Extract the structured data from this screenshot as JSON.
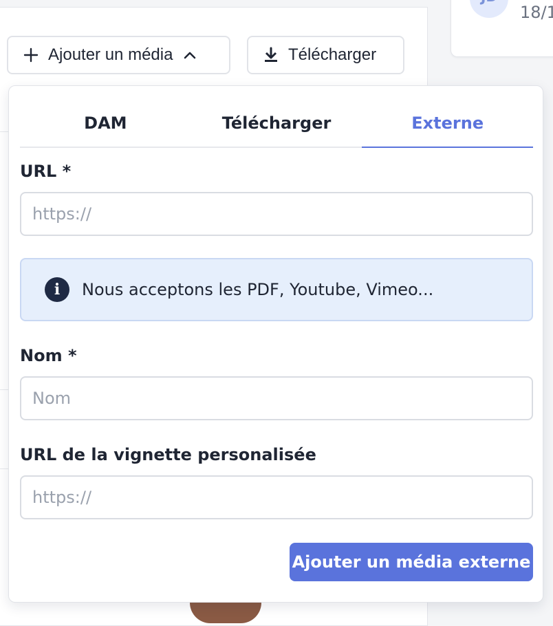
{
  "background": {
    "avatar_initials": "JD",
    "date_partial": "18/1"
  },
  "toolbar": {
    "add_media_label": "Ajouter un média",
    "download_label": "Télécharger"
  },
  "popover": {
    "tabs": [
      {
        "label": "DAM",
        "active": false
      },
      {
        "label": "Télécharger",
        "active": false
      },
      {
        "label": "Externe",
        "active": true
      }
    ],
    "url_label": "URL *",
    "url_placeholder": "https://",
    "info_text": "Nous acceptons les PDF, Youtube, Vimeo...",
    "name_label": "Nom *",
    "name_placeholder": "Nom",
    "thumbnail_label": "URL de la vignette personalisée",
    "thumbnail_placeholder": "https://",
    "submit_label": "Ajouter un média externe"
  },
  "colors": {
    "accent": "#5a73dc",
    "info_bg": "#e6effc",
    "text": "#1f2533"
  }
}
